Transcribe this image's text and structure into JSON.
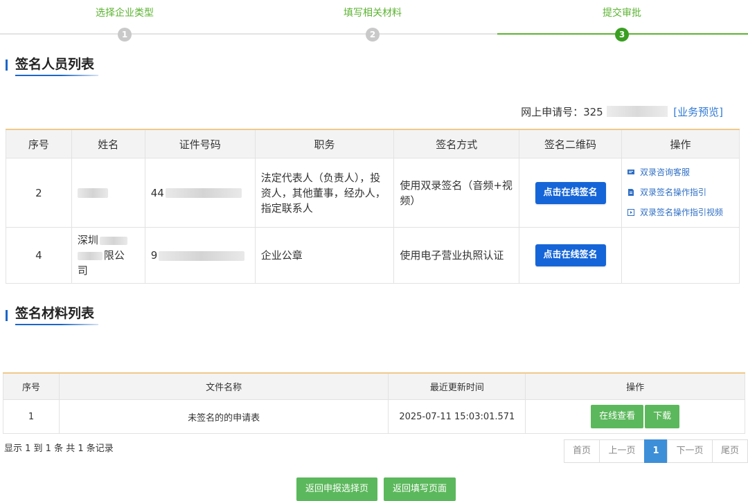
{
  "steps": [
    {
      "num": "1",
      "label": "选择企业类型"
    },
    {
      "num": "2",
      "label": "填写相关材料"
    },
    {
      "num": "3",
      "label": "提交审批"
    }
  ],
  "signers_section": {
    "title": "签名人员列表",
    "apply_no_label": "网上申请号：325",
    "preview_link": "[业务预览]",
    "headers": [
      "序号",
      "姓名",
      "证件号码",
      "职务",
      "签名方式",
      "签名二维码",
      "操作"
    ],
    "rows": [
      {
        "seq": "2",
        "name": "",
        "id_prefix": "44",
        "role": "法定代表人（负责人），投资人，其他董事，经办人，指定联系人",
        "method": "使用双录签名（音频+视频）",
        "sign_button": "点击在线签名",
        "ops": [
          "双录咨询客服",
          "双录签名操作指引",
          "双录签名操作指引视频"
        ]
      },
      {
        "seq": "4",
        "name_line1": "深圳",
        "name_line2": "限公",
        "name_line3": "司",
        "id_prefix": "9",
        "role": "企业公章",
        "method": "使用电子营业执照认证",
        "sign_button": "点击在线签名"
      }
    ]
  },
  "materials_section": {
    "title": "签名材料列表",
    "headers": [
      "序号",
      "文件名称",
      "最近更新时间",
      "操作"
    ],
    "rows": [
      {
        "seq": "1",
        "file": "未签名的的申请表",
        "updated": "2025-07-11 15:03:01.571",
        "view": "在线查看",
        "download": "下载"
      }
    ],
    "records_text": "显示 1 到 1 条 共 1 条记录",
    "pager": [
      "首页",
      "上一页",
      "1",
      "下一页",
      "尾页"
    ]
  },
  "bottom_buttons": [
    "返回申报选择页",
    "返回填写页面"
  ],
  "colors": {
    "accent_blue": "#1565d8",
    "green": "#5cb85c",
    "step_green": "#5bb330",
    "header_border": "#f0c98a"
  }
}
